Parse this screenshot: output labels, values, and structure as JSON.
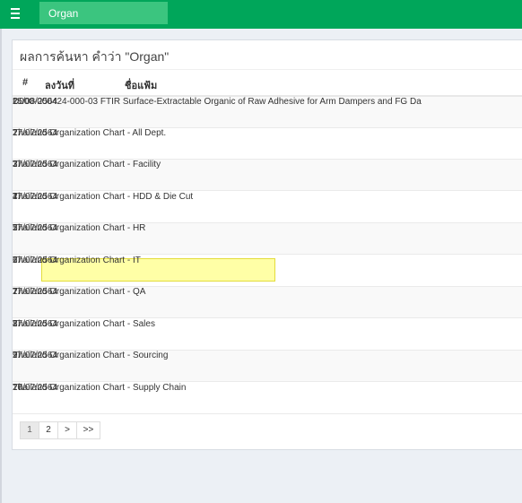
{
  "header": {
    "search_value": "Organ",
    "menu_icon": "hamburger-menu-icon",
    "color": "#00a65a"
  },
  "results": {
    "title": "ผลการค้นหา คำว่า \"Organ\"",
    "columns": [
      "#",
      "ลงวันที่",
      "ชื่อแฟ้ม"
    ],
    "rows": [
      {
        "num": "1.",
        "date": "25/08/2564",
        "name": "D000-000424-000-03 FTIR Surface-Extractable Organic of Raw Adhesive for Arm Dampers and FG Da"
      },
      {
        "num": "2.",
        "date": "27/07/2564",
        "name": "Thailand Organization Chart - All Dept."
      },
      {
        "num": "3.",
        "date": "27/07/2564",
        "name": "Thailand Organization Chart - Facility"
      },
      {
        "num": "4.",
        "date": "27/07/2564",
        "name": "Thailand Organization Chart - HDD & Die Cut"
      },
      {
        "num": "5.",
        "date": "27/07/2564",
        "name": "Thailand Organization Chart - HR"
      },
      {
        "num": "6.",
        "date": "27/07/2564",
        "name": "Thailand Organization Chart - IT"
      },
      {
        "num": "7.",
        "date": "27/07/2564",
        "name": "Thailand Organization Chart - QA"
      },
      {
        "num": "8.",
        "date": "27/07/2564",
        "name": "Thailand Organization Chart - Sales"
      },
      {
        "num": "9.",
        "date": "27/07/2564",
        "name": "Thailand Organization Chart - Sourcing"
      },
      {
        "num": "10.",
        "date": "27/07/2564",
        "name": "Thailand Organization Chart - Supply Chain"
      }
    ]
  },
  "pagination": {
    "pages": [
      "1",
      "2",
      ">",
      ">>"
    ],
    "active": "1"
  }
}
